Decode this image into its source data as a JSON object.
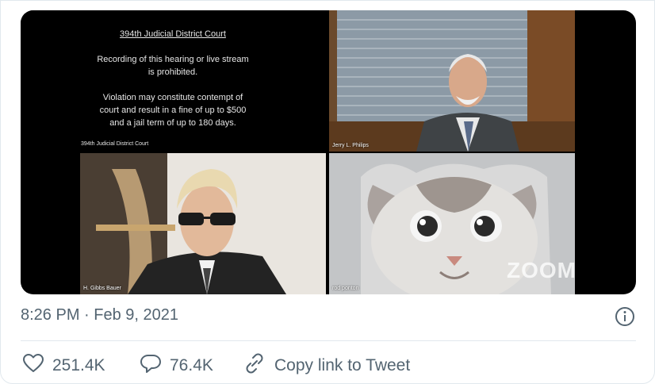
{
  "media": {
    "notice": {
      "title": "394th Judicial District Court",
      "line1": "Recording of this hearing or live stream",
      "line2": "is prohibited.",
      "line3": "Violation may constitute contempt of",
      "line4": "court and result in a fine of up to $500",
      "line5": "and a jail term of up to 180 days.",
      "footer": "394th Judicial District Court"
    },
    "judge_label": "Jerry L. Philips",
    "lawyer_label": "H. Gibbs Bauer",
    "cat_label": "rod ponton",
    "zoom_watermark": "ZOOM"
  },
  "tweet": {
    "timestamp": "8:26 PM · Feb 9, 2021",
    "likes": "251.4K",
    "replies": "76.4K",
    "copy_link_label": "Copy link to Tweet"
  },
  "colors": {
    "text_secondary": "#536471",
    "divider": "#e1e8ed"
  },
  "icons": {
    "info": "info-icon",
    "like": "heart-icon",
    "reply": "speech-bubble-icon",
    "copy_link": "link-icon"
  }
}
